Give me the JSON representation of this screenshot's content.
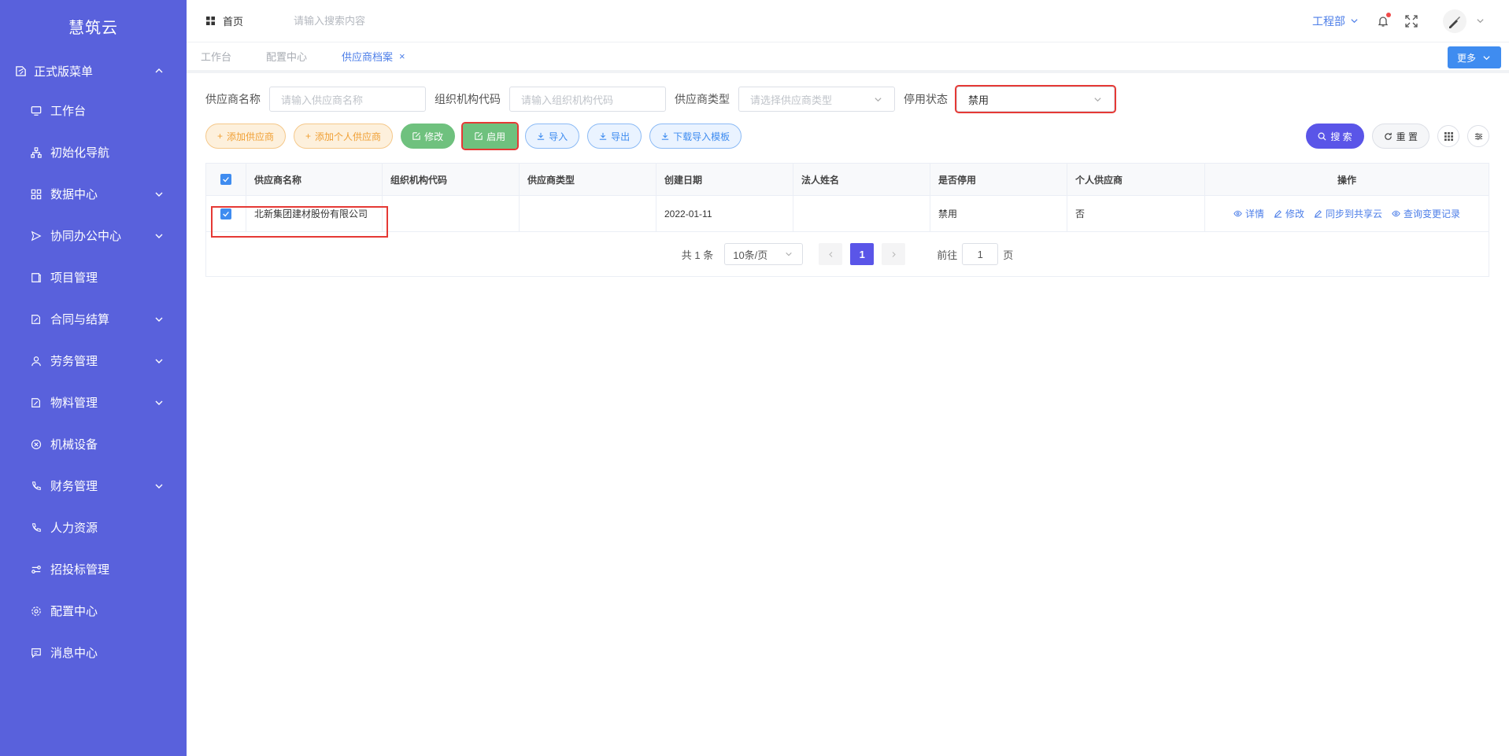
{
  "app": {
    "title": "慧筑云"
  },
  "sidebar": {
    "group": {
      "label": "正式版菜单"
    },
    "items": [
      {
        "label": "工作台",
        "icon": "monitor-icon",
        "expandable": false
      },
      {
        "label": "初始化导航",
        "icon": "sitemap-icon",
        "expandable": false
      },
      {
        "label": "数据中心",
        "icon": "grid-icon",
        "expandable": true
      },
      {
        "label": "协同办公中心",
        "icon": "send-icon",
        "expandable": true
      },
      {
        "label": "项目管理",
        "icon": "book-icon",
        "expandable": false
      },
      {
        "label": "合同与结算",
        "icon": "edit-doc-icon",
        "expandable": true
      },
      {
        "label": "劳务管理",
        "icon": "worker-icon",
        "expandable": true
      },
      {
        "label": "物料管理",
        "icon": "edit-doc-icon",
        "expandable": true
      },
      {
        "label": "机械设备",
        "icon": "close-circle-icon",
        "expandable": false
      },
      {
        "label": "财务管理",
        "icon": "phone-icon",
        "expandable": true
      },
      {
        "label": "人力资源",
        "icon": "phone-icon",
        "expandable": false
      },
      {
        "label": "招投标管理",
        "icon": "link-icon",
        "expandable": false
      },
      {
        "label": "配置中心",
        "icon": "gear-icon",
        "expandable": false
      },
      {
        "label": "消息中心",
        "icon": "message-icon",
        "expandable": false
      }
    ]
  },
  "header": {
    "home_label": "首页",
    "search_placeholder": "请输入搜索内容",
    "dept_label": "工程部"
  },
  "tabs": [
    {
      "label": "工作台",
      "active": false
    },
    {
      "label": "配置中心",
      "active": false
    },
    {
      "label": "供应商档案",
      "active": true,
      "close": "×"
    }
  ],
  "more_label": "更多",
  "filters": {
    "name": {
      "label": "供应商名称",
      "placeholder": "请输入供应商名称"
    },
    "org_code": {
      "label": "组织机构代码",
      "placeholder": "请输入组织机构代码"
    },
    "type": {
      "label": "供应商类型",
      "placeholder": "请选择供应商类型"
    },
    "status": {
      "label": "停用状态",
      "value": "禁用"
    }
  },
  "actions": {
    "add_supplier": "添加供应商",
    "add_personal": "添加个人供应商",
    "edit": "修改",
    "enable": "启用",
    "import": "导入",
    "export": "导出",
    "download_template": "下载导入模板",
    "search": "搜 索",
    "reset": "重 置"
  },
  "table": {
    "columns": [
      "供应商名称",
      "组织机构代码",
      "供应商类型",
      "创建日期",
      "法人姓名",
      "是否停用",
      "个人供应商",
      "操作"
    ],
    "rows": [
      {
        "name": "北新集团建材股份有限公司",
        "org_code": "",
        "type": "",
        "created": "2022-01-11",
        "legal_person": "",
        "disabled": "禁用",
        "personal": "否",
        "ops": [
          "详情",
          "修改",
          "同步到共享云",
          "查询变更记录"
        ]
      }
    ]
  },
  "pagination": {
    "total": "共 1 条",
    "page_size": "10条/页",
    "current": "1",
    "goto_label": "前往",
    "goto_value": "1",
    "page_suffix": "页"
  },
  "colors": {
    "sidebar": "#5961dc",
    "accent": "#5a55e8",
    "link": "#4c7ee8",
    "highlight": "#e53935"
  }
}
